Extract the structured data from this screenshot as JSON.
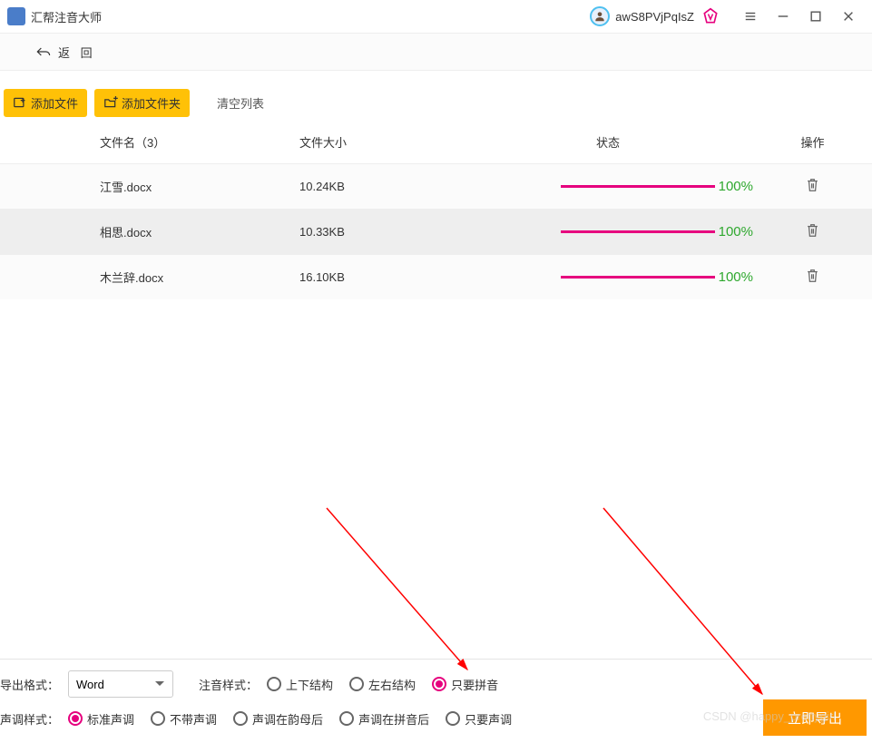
{
  "app": {
    "title": "汇帮注音大师",
    "username": "awS8PVjPqIsZ"
  },
  "backbar": {
    "label": "返 回"
  },
  "toolbar": {
    "add_file": "添加文件",
    "add_folder": "添加文件夹",
    "clear_list": "清空列表"
  },
  "table": {
    "headers": {
      "name": "文件名（3）",
      "size": "文件大小",
      "status": "状态",
      "action": "操作"
    },
    "rows": [
      {
        "name": "江雪.docx",
        "size": "10.24KB",
        "progress": "100%"
      },
      {
        "name": "相思.docx",
        "size": "10.33KB",
        "progress": "100%"
      },
      {
        "name": "木兰辞.docx",
        "size": "16.10KB",
        "progress": "100%"
      }
    ]
  },
  "options": {
    "export_format_label": "导出格式：",
    "export_format_value": "Word",
    "pinyin_style_label": "注音样式：",
    "pinyin_styles": [
      {
        "label": "上下结构",
        "checked": false
      },
      {
        "label": "左右结构",
        "checked": false
      },
      {
        "label": "只要拼音",
        "checked": true
      }
    ],
    "tone_style_label": "声调样式：",
    "tone_styles": [
      {
        "label": "标准声调",
        "checked": true
      },
      {
        "label": "不带声调",
        "checked": false
      },
      {
        "label": "声调在韵母后",
        "checked": false
      },
      {
        "label": "声调在拼音后",
        "checked": false
      },
      {
        "label": "只要声调",
        "checked": false
      }
    ],
    "export_button": "立即导出"
  },
  "watermark": "CSDN @happy_prettygirl"
}
